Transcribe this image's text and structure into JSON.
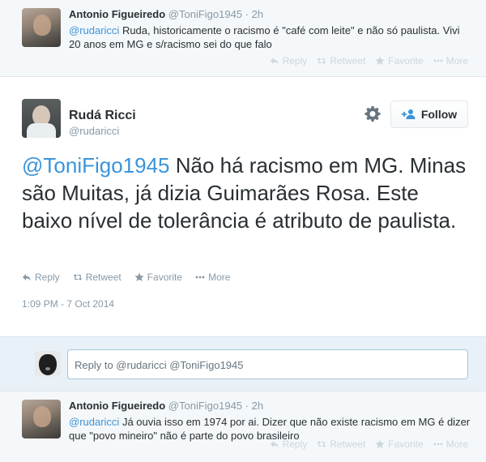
{
  "actions": {
    "reply": "Reply",
    "retweet": "Retweet",
    "favorite": "Favorite",
    "more": "More"
  },
  "tweet_top": {
    "fullname": "Antonio Figueiredo",
    "handle": "@ToniFigo1945",
    "dot": "·",
    "time": "2h",
    "mention": "@rudaricci",
    "text": " Ruda, historicamente o racismo é \"café com leite\" e não só paulista. Vivi 20 anos em MG e s/racismo sei do que falo"
  },
  "main_tweet": {
    "fullname": "Rudá Ricci",
    "handle": "@rudaricci",
    "follow_label": "Follow",
    "mention": "@ToniFigo1945",
    "text": " Não há racismo em MG. Minas são Muitas, já dizia Guimarães Rosa. Este baixo nível de tolerância é atributo de paulista.",
    "date": "1:09 PM - 7 Oct 2014"
  },
  "reply_box": {
    "placeholder": "Reply to @rudaricci @ToniFigo1945"
  },
  "tweet_bottom": {
    "fullname": "Antonio Figueiredo",
    "handle": "@ToniFigo1945",
    "dot": "·",
    "time": "2h",
    "mention": "@rudaricci",
    "text": " Já ouvia isso em 1974 por ai. Dizer que não existe racismo em MG é dizer que \"povo mineiro\" não é parte do povo brasileiro"
  },
  "colors": {
    "link": "#3b94d9",
    "muted": "#8899a6",
    "reply_bg": "#e8f1f8"
  }
}
